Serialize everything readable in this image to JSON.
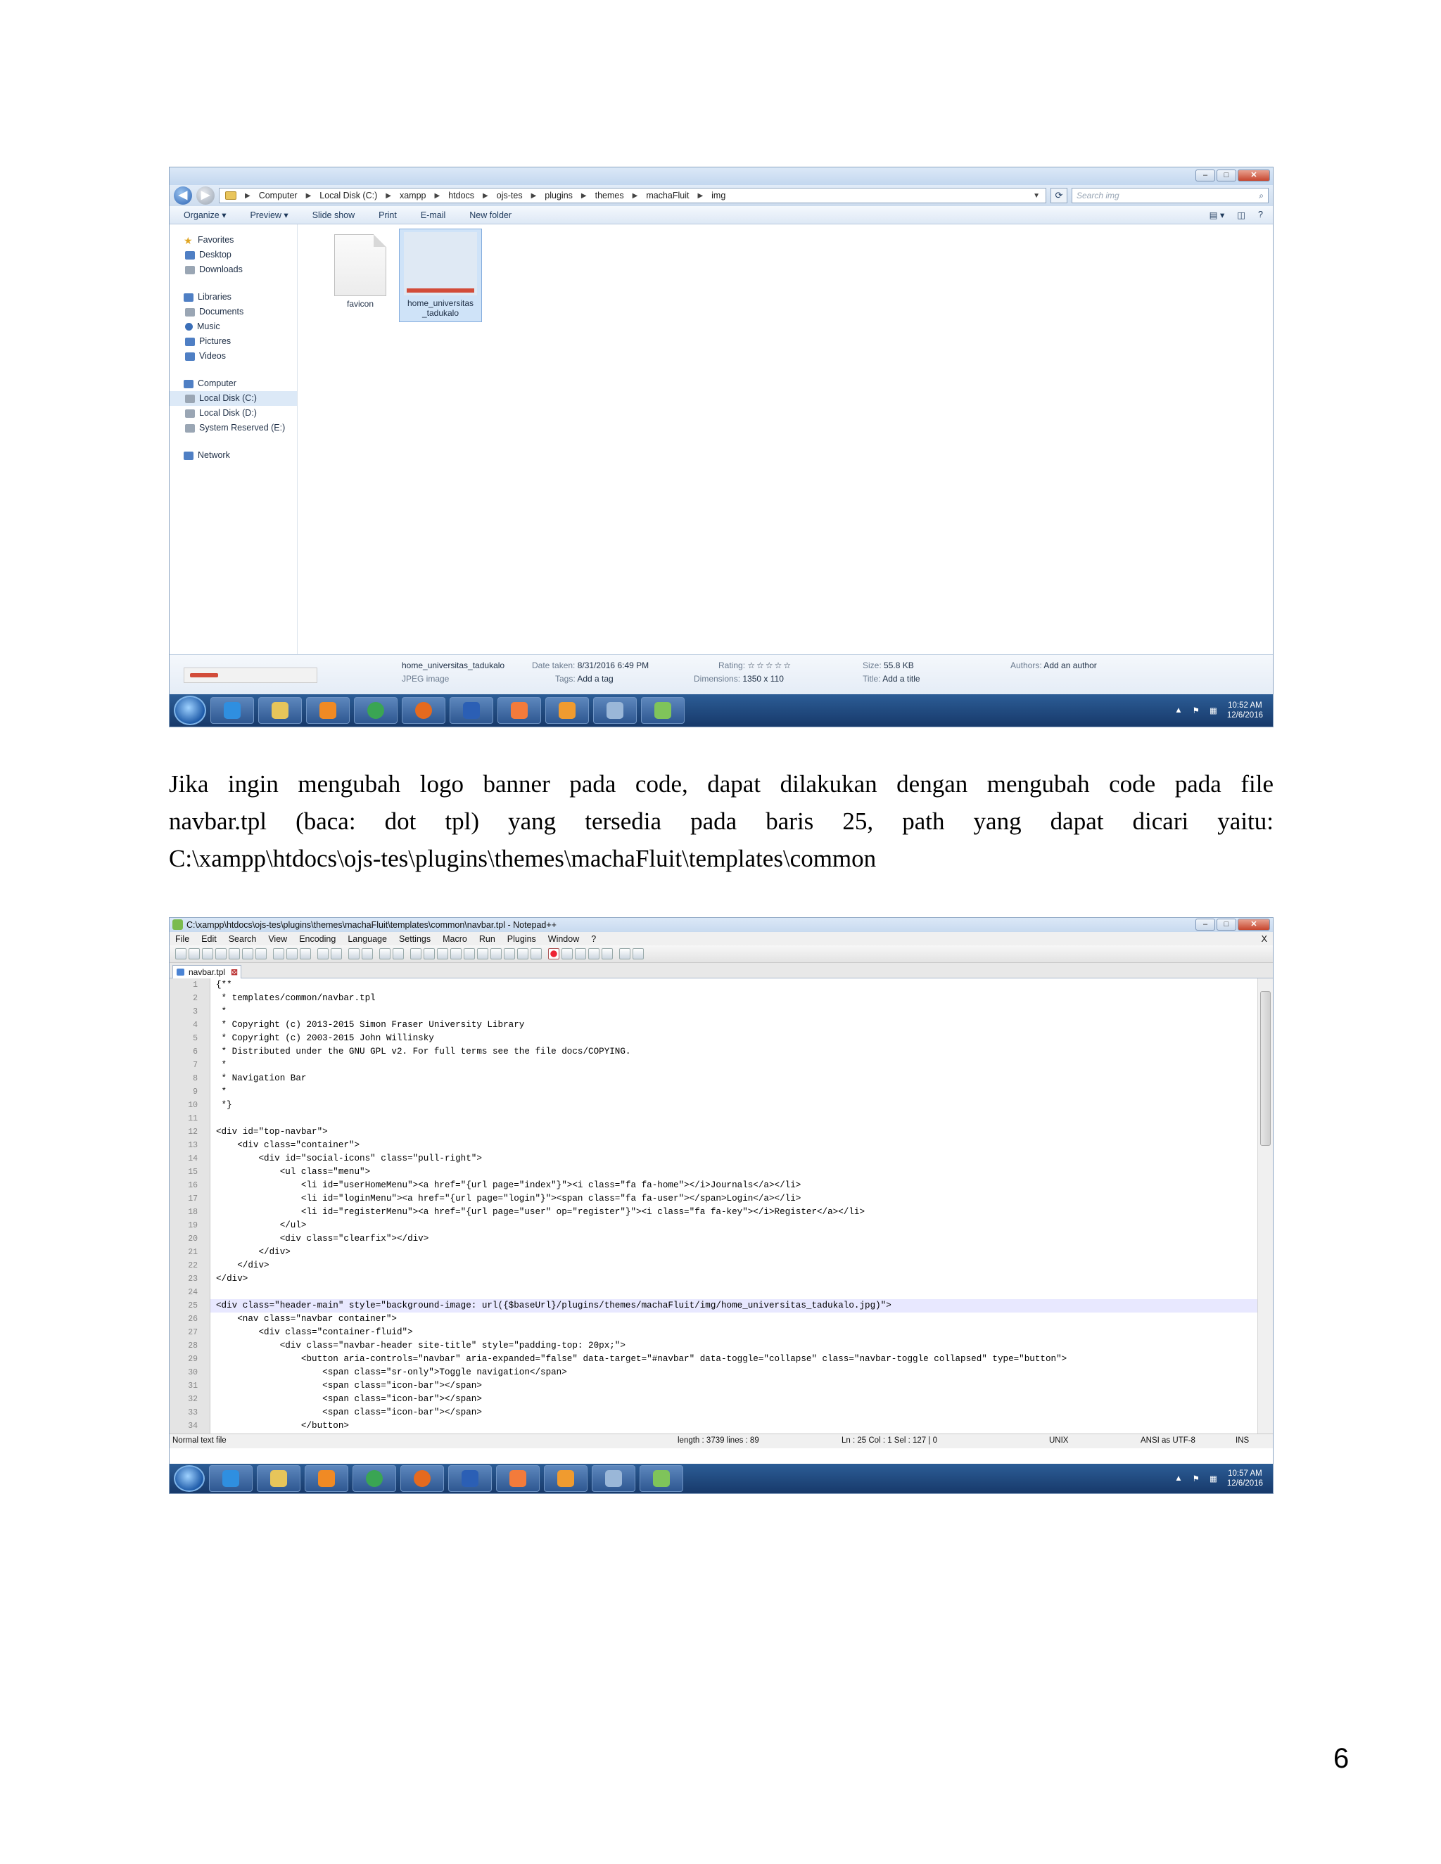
{
  "explorer": {
    "breadcrumbs": [
      "Computer",
      "Local Disk (C:)",
      "xampp",
      "htdocs",
      "ojs-tes",
      "plugins",
      "themes",
      "machaFluit",
      "img"
    ],
    "search_placeholder": "Search img",
    "toolbar": [
      "Organize ▾",
      "Preview ▾",
      "Slide show",
      "Print",
      "E-mail",
      "New folder"
    ],
    "nav": {
      "favorites": {
        "label": "Favorites",
        "items": [
          "Desktop",
          "Downloads"
        ]
      },
      "libraries": {
        "label": "Libraries",
        "items": [
          "Documents",
          "Music",
          "Pictures",
          "Videos"
        ]
      },
      "computer": {
        "label": "Computer",
        "items": [
          "Local Disk (C:)",
          "Local Disk (D:)",
          "System Reserved (E:)"
        ]
      },
      "network": {
        "label": "Network"
      }
    },
    "files": [
      {
        "name": "favicon"
      },
      {
        "name": "home_universitas _tadukalo"
      }
    ],
    "details": {
      "filename": "home_universitas_tadukalo",
      "filetype": "JPEG image",
      "date_label": "Date taken:",
      "date_value": "8/31/2016 6:49 PM",
      "tags_label": "Tags:",
      "tags_value": "Add a tag",
      "rating_label": "Rating:",
      "rating_value": "☆☆☆☆☆",
      "dim_label": "Dimensions:",
      "dim_value": "1350 x 110",
      "size_label": "Size:",
      "size_value": "55.8 KB",
      "title_label": "Title:",
      "title_value": "Add a title",
      "authors_label": "Authors:",
      "authors_value": "Add an author"
    },
    "clock": {
      "time": "10:52 AM",
      "date": "12/6/2016"
    }
  },
  "paragraph": {
    "line1": "Jika ingin mengubah logo banner pada code, dapat dilakukan dengan mengubah code pada file",
    "line2": "navbar.tpl (baca: dot tpl) yang tersedia pada baris 25, path yang dapat dicari yaitu:",
    "line3": "C:\\xampp\\htdocs\\ojs-tes\\plugins\\themes\\machaFluit\\templates\\common"
  },
  "notepad": {
    "title": "C:\\xampp\\htdocs\\ojs-tes\\plugins\\themes\\machaFluit\\templates\\common\\navbar.tpl - Notepad++",
    "menu": [
      "File",
      "Edit",
      "Search",
      "View",
      "Encoding",
      "Language",
      "Settings",
      "Macro",
      "Run",
      "Plugins",
      "Window",
      "?"
    ],
    "close_x": "X",
    "tab": "navbar.tpl",
    "lines": [
      {
        "n": "1",
        "t": "{**"
      },
      {
        "n": "2",
        "t": " * templates/common/navbar.tpl"
      },
      {
        "n": "3",
        "t": " *"
      },
      {
        "n": "4",
        "t": " * Copyright (c) 2013-2015 Simon Fraser University Library"
      },
      {
        "n": "5",
        "t": " * Copyright (c) 2003-2015 John Willinsky"
      },
      {
        "n": "6",
        "t": " * Distributed under the GNU GPL v2. For full terms see the file docs/COPYING."
      },
      {
        "n": "7",
        "t": " *"
      },
      {
        "n": "8",
        "t": " * Navigation Bar"
      },
      {
        "n": "9",
        "t": " *"
      },
      {
        "n": "10",
        "t": " *}"
      },
      {
        "n": "11",
        "t": ""
      },
      {
        "n": "12",
        "t": "<div id=\"top-navbar\">"
      },
      {
        "n": "13",
        "t": "    <div class=\"container\">"
      },
      {
        "n": "14",
        "t": "        <div id=\"social-icons\" class=\"pull-right\">"
      },
      {
        "n": "15",
        "t": "            <ul class=\"menu\">"
      },
      {
        "n": "16",
        "t": "                <li id=\"userHomeMenu\"><a href=\"{url page=\"index\"}\"><i class=\"fa fa-home\"></i>Journals</a></li>"
      },
      {
        "n": "17",
        "t": "                <li id=\"loginMenu\"><a href=\"{url page=\"login\"}\"><span class=\"fa fa-user\"></span>Login</a></li>"
      },
      {
        "n": "18",
        "t": "                <li id=\"registerMenu\"><a href=\"{url page=\"user\" op=\"register\"}\"><i class=\"fa fa-key\"></i>Register</a></li>"
      },
      {
        "n": "19",
        "t": "            </ul>"
      },
      {
        "n": "20",
        "t": "            <div class=\"clearfix\"></div>"
      },
      {
        "n": "21",
        "t": "        </div>"
      },
      {
        "n": "22",
        "t": "    </div>"
      },
      {
        "n": "23",
        "t": "</div>"
      },
      {
        "n": "24",
        "t": ""
      },
      {
        "n": "25",
        "t": "<div class=\"header-main\" style=\"background-image: url({$baseUrl}/plugins/themes/machaFluit/img/home_universitas_tadukalo.jpg)\">"
      },
      {
        "n": "26",
        "t": "    <nav class=\"navbar container\">"
      },
      {
        "n": "27",
        "t": "        <div class=\"container-fluid\">"
      },
      {
        "n": "28",
        "t": "            <div class=\"navbar-header site-title\" style=\"padding-top: 20px;\">"
      },
      {
        "n": "29",
        "t": "                <button aria-controls=\"navbar\" aria-expanded=\"false\" data-target=\"#navbar\" data-toggle=\"collapse\" class=\"navbar-toggle collapsed\" type=\"button\">"
      },
      {
        "n": "30",
        "t": "                    <span class=\"sr-only\">Toggle navigation</span>"
      },
      {
        "n": "31",
        "t": "                    <span class=\"icon-bar\"></span>"
      },
      {
        "n": "32",
        "t": "                    <span class=\"icon-bar\"></span>"
      },
      {
        "n": "33",
        "t": "                    <span class=\"icon-bar\"></span>"
      },
      {
        "n": "34",
        "t": "                </button>"
      }
    ],
    "status": {
      "filetype": "Normal text file",
      "length": "length : 3739    lines : 89",
      "pos": "Ln : 25    Col : 1    Sel : 127 | 0",
      "eol": "UNIX",
      "enc": "ANSI as UTF-8",
      "mode": "INS"
    },
    "clock": {
      "time": "10:57 AM",
      "date": "12/6/2016"
    }
  },
  "page_number": "6"
}
